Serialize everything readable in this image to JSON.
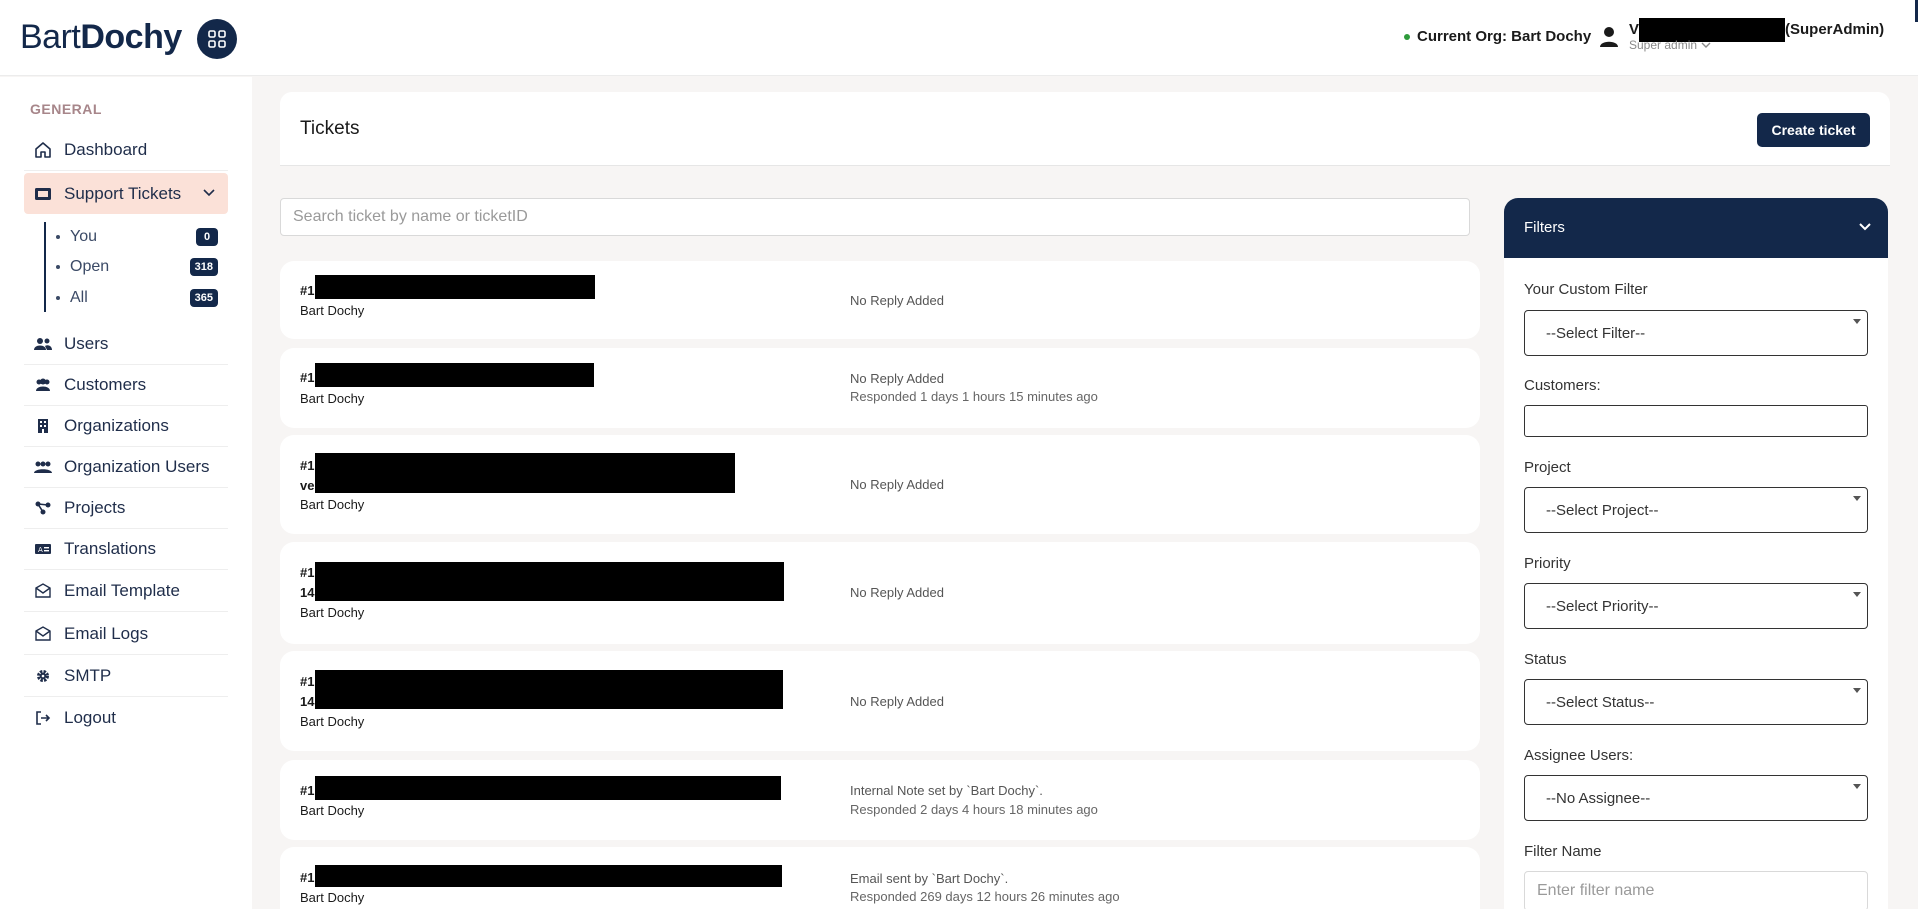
{
  "header": {
    "logo_light": "Bart",
    "logo_bold": "Dochy",
    "current_org": "Current Org: Bart Dochy",
    "user_initial": "V",
    "user_suffix": "(SuperAdmin)",
    "user_role": "Super admin"
  },
  "sidebar": {
    "section": "GENERAL",
    "items": [
      {
        "label": "Dashboard",
        "icon": "home-icon"
      },
      {
        "label": "Support Tickets",
        "icon": "ticket-icon"
      },
      {
        "label": "Users",
        "icon": "users-icon"
      },
      {
        "label": "Customers",
        "icon": "customers-icon"
      },
      {
        "label": "Organizations",
        "icon": "building-icon"
      },
      {
        "label": "Organization Users",
        "icon": "org-users-icon"
      },
      {
        "label": "Projects",
        "icon": "projects-icon"
      },
      {
        "label": "Translations",
        "icon": "translation-icon"
      },
      {
        "label": "Email Template",
        "icon": "email-icon"
      },
      {
        "label": "Email Logs",
        "icon": "email-icon"
      },
      {
        "label": "SMTP",
        "icon": "gear-icon"
      },
      {
        "label": "Logout",
        "icon": "logout-icon"
      }
    ],
    "sub_items": [
      {
        "label": "You",
        "count": "0"
      },
      {
        "label": "Open",
        "count": "318"
      },
      {
        "label": "All",
        "count": "365"
      }
    ]
  },
  "main": {
    "title": "Tickets",
    "create_button": "Create ticket",
    "search_placeholder": "Search ticket by name or ticketID"
  },
  "tickets": [
    {
      "id": "#1",
      "id2": "",
      "org": "Bart Dochy",
      "status": "No Reply Added",
      "responded": ""
    },
    {
      "id": "#1",
      "id2": "",
      "org": "Bart Dochy",
      "status": "No Reply Added",
      "responded": "Responded 1 days 1 hours 15 minutes ago"
    },
    {
      "id": "#1",
      "id2": "ve",
      "org": "Bart Dochy",
      "status": "No Reply Added",
      "responded": ""
    },
    {
      "id": "#1",
      "id2": "14",
      "org": "Bart Dochy",
      "status": "No Reply Added",
      "responded": ""
    },
    {
      "id": "#1",
      "id2": "14",
      "org": "Bart Dochy",
      "status": "No Reply Added",
      "responded": ""
    },
    {
      "id": "#1",
      "id2": "",
      "org": "Bart Dochy",
      "status": "Internal Note set by `Bart Dochy`.",
      "responded": "Responded 2 days 4 hours 18 minutes ago"
    },
    {
      "id": "#1",
      "id2": "",
      "org": "Bart Dochy",
      "status": "Email sent by `Bart Dochy`.",
      "responded": "Responded 269 days 12 hours 26 minutes ago"
    }
  ],
  "filters": {
    "title": "Filters",
    "custom_filter_label": "Your Custom Filter",
    "custom_filter_value": "--Select Filter--",
    "customers_label": "Customers:",
    "project_label": "Project",
    "project_value": "--Select Project--",
    "priority_label": "Priority",
    "priority_value": "--Select Priority--",
    "status_label": "Status",
    "status_value": "--Select Status--",
    "assignee_label": "Assignee Users:",
    "assignee_value": "--No Assignee--",
    "filter_name_label": "Filter Name",
    "filter_name_placeholder": "Enter filter name"
  }
}
